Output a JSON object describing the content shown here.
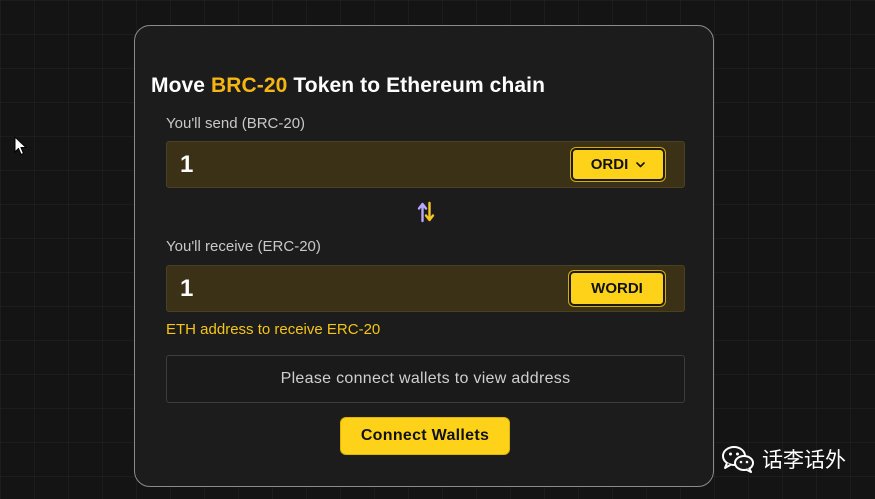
{
  "title": {
    "prefix": "Move ",
    "highlight": "BRC-20",
    "suffix": " Token to Ethereum chain"
  },
  "send": {
    "label": "You'll send (BRC-20)",
    "amount": "1",
    "token": "ORDI",
    "token_icon": "chevron-down-icon"
  },
  "swap_icon": "swap-arrows-icon",
  "receive": {
    "label": "You'll receive (ERC-20)",
    "amount": "1",
    "token": "WORDI"
  },
  "eth_address": {
    "label": "ETH address to receive ERC-20",
    "placeholder": "Please connect wallets to view address"
  },
  "connect_button": "Connect Wallets",
  "watermark": {
    "text": "话李话外",
    "icon": "wechat-icon"
  },
  "colors": {
    "accent": "#f5b614",
    "button": "#ffd21a",
    "eth_label": "#f5c518",
    "card_bg": "#1c1c1c",
    "page_bg": "#141414"
  }
}
